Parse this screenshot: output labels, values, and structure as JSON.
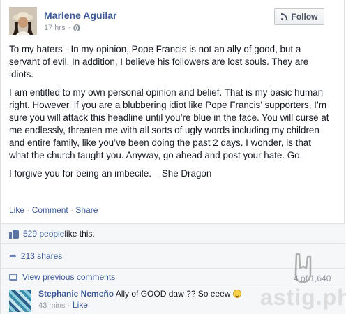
{
  "post": {
    "author": "Marlene Aguilar",
    "time": "17 hrs",
    "privacy_sep": "·",
    "follow_label": "Follow",
    "paragraphs": [
      "To my haters - In my opinion, Pope Francis is not an ally of good, but a servant of evil. In addition, I believe his followers are lost souls. They are idiots.",
      "I am entitled to my own personal opinion and belief. That is my basic human right. However, if you are a blubbering idiot like Pope Francis’ supporters, I’m sure you will attack this headline until you’re blue in the face. You will curse at me endlessly, threaten me with all sorts of ugly words including my children and entire family, like you’ve been doing the past 2 days. I wonder, is that what the church taught you. Anyway, go ahead and post your hate. Go.",
      "I forgive you for being an imbecile. – She Dragon"
    ],
    "actions": {
      "like": "Like",
      "comment": "Comment",
      "share": "Share",
      "sep": "·"
    }
  },
  "feedback": {
    "likes_link": "529 people",
    "likes_suffix": " like this.",
    "shares": "213 shares",
    "view_previous": "View previous comments",
    "pager": "4 of 1,640"
  },
  "comment": {
    "author": "Stephanie Nemeño",
    "text": " Ally of GOOD daw ?? So eeew ",
    "time": "43 mins",
    "like": "Like",
    "sep": "·"
  },
  "watermark": "astig.ph",
  "colors": {
    "link": "#3b5998",
    "muted": "#9197a3",
    "ufi_bg": "#f6f7f8"
  }
}
